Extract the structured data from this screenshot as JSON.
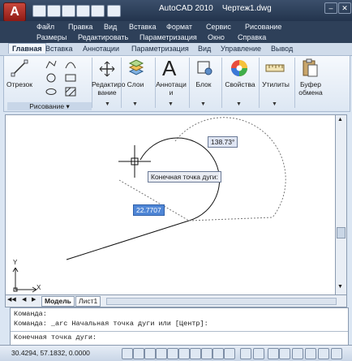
{
  "window": {
    "app_name": "AutoCAD 2010",
    "document": "Чертеж1.dwg",
    "app_button_icon": "autocad-logo-icon"
  },
  "menu": {
    "row1": [
      "Файл",
      "Правка",
      "Вид",
      "Вставка",
      "Формат",
      "Сервис",
      "Рисование"
    ],
    "row2": [
      "Размеры",
      "Редактировать",
      "Параметризация",
      "Окно",
      "Справка"
    ]
  },
  "ribbon_tabs": [
    "Главная",
    "Вставка",
    "Аннотации",
    "Параметризация",
    "Вид",
    "Управление",
    "Вывод"
  ],
  "ribbon": {
    "line_label": "Отрезок",
    "draw_panel": "Рисование",
    "edit_label_1": "Редактиро",
    "edit_label_2": "вание",
    "layers_label": "Слои",
    "annot_label_1": "Аннотаци",
    "annot_label_2": "и",
    "annot_letter": "A",
    "block_label": "Блок",
    "props_label": "Свойства",
    "utils_label": "Утилиты",
    "clip_label_1": "Буфер",
    "clip_label_2": "обмена"
  },
  "drawing": {
    "angle_value": "138.73°",
    "prompt": "Конечная точка дуги:",
    "length_value": "22.7707",
    "ucs_x": "X",
    "ucs_y": "Y"
  },
  "layout_tabs": [
    "Модель",
    "Лист1"
  ],
  "command_lines": [
    "Команда:",
    "Команда: _arc Начальная точка дуги или [Центр]:",
    "Конечная точка дуги:"
  ],
  "status": {
    "coords": "30.4294, 57.1832, 0.0000"
  },
  "colors": {
    "title_bar": "#23344d",
    "menu_bar": "#2e4059",
    "ribbon_bg": "#dde7f3",
    "accent_red": "#b3271e"
  }
}
